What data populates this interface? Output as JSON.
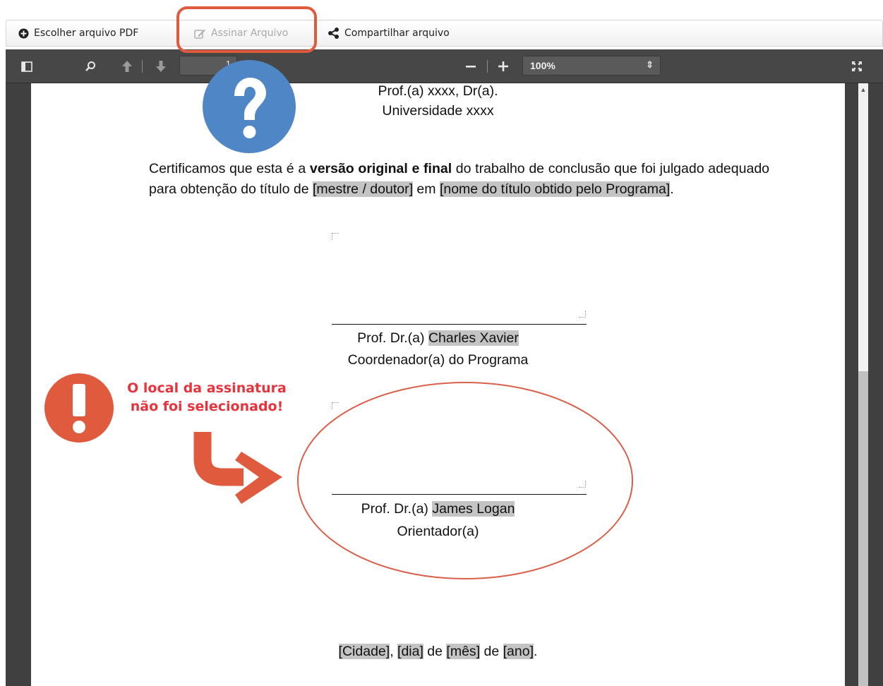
{
  "toolbar": {
    "choose_pdf_label": "Escolher arquivo PDF",
    "sign_file_label": "Assinar Arquivo",
    "share_file_label": "Compartilhar arquivo"
  },
  "viewer": {
    "page_number": "1",
    "zoom_value": "100%"
  },
  "document": {
    "examiner_name": "Prof.(a)  xxxx, Dr(a).",
    "examiner_institution": "Universidade xxxx",
    "certification": {
      "part1": "Certificamos que esta é a ",
      "bold": "versão original e final",
      "part2": " do trabalho de conclusão que foi julgado adequado para obtenção do título de ",
      "degree_placeholder": "[mestre / doutor]",
      "part3": " em ",
      "title_placeholder": "[nome do título obtido pelo Programa]",
      "end": "."
    },
    "coordinator": {
      "prefix": "Prof. Dr.(a) ",
      "name": "Charles Xavier",
      "role": "Coordenador(a) do Programa"
    },
    "advisor": {
      "prefix": "Prof. Dr.(a) ",
      "name": "James Logan",
      "role": "Orientador(a)"
    },
    "date_line": {
      "city": "[Cidade]",
      "sep1": ", ",
      "day": "[dia]",
      "sep2": " de ",
      "month": "[mês]",
      "sep3": " de ",
      "year": "[ano]",
      "end": "."
    }
  },
  "annotations": {
    "warning_line1": "O local da assinatura",
    "warning_line2": "não foi selecionado!"
  },
  "colors": {
    "annotation_red": "#e05a3d",
    "question_blue": "#4f86c6",
    "warning_text": "#e8323c",
    "highlight_gray": "#c4c4c4"
  },
  "icons": {
    "choose_pdf": "plus-circle-icon",
    "sign_file": "edit-icon",
    "share_file": "share-icon",
    "sidebar": "sidebar-toggle-icon",
    "search": "search-icon",
    "prev_page": "arrow-up-icon",
    "next_page": "arrow-down-icon",
    "zoom_out": "minus-icon",
    "zoom_in": "plus-icon",
    "fullscreen": "fullscreen-icon",
    "help": "question-mark-icon",
    "warning": "exclamation-icon",
    "arrow": "curved-arrow-icon"
  }
}
